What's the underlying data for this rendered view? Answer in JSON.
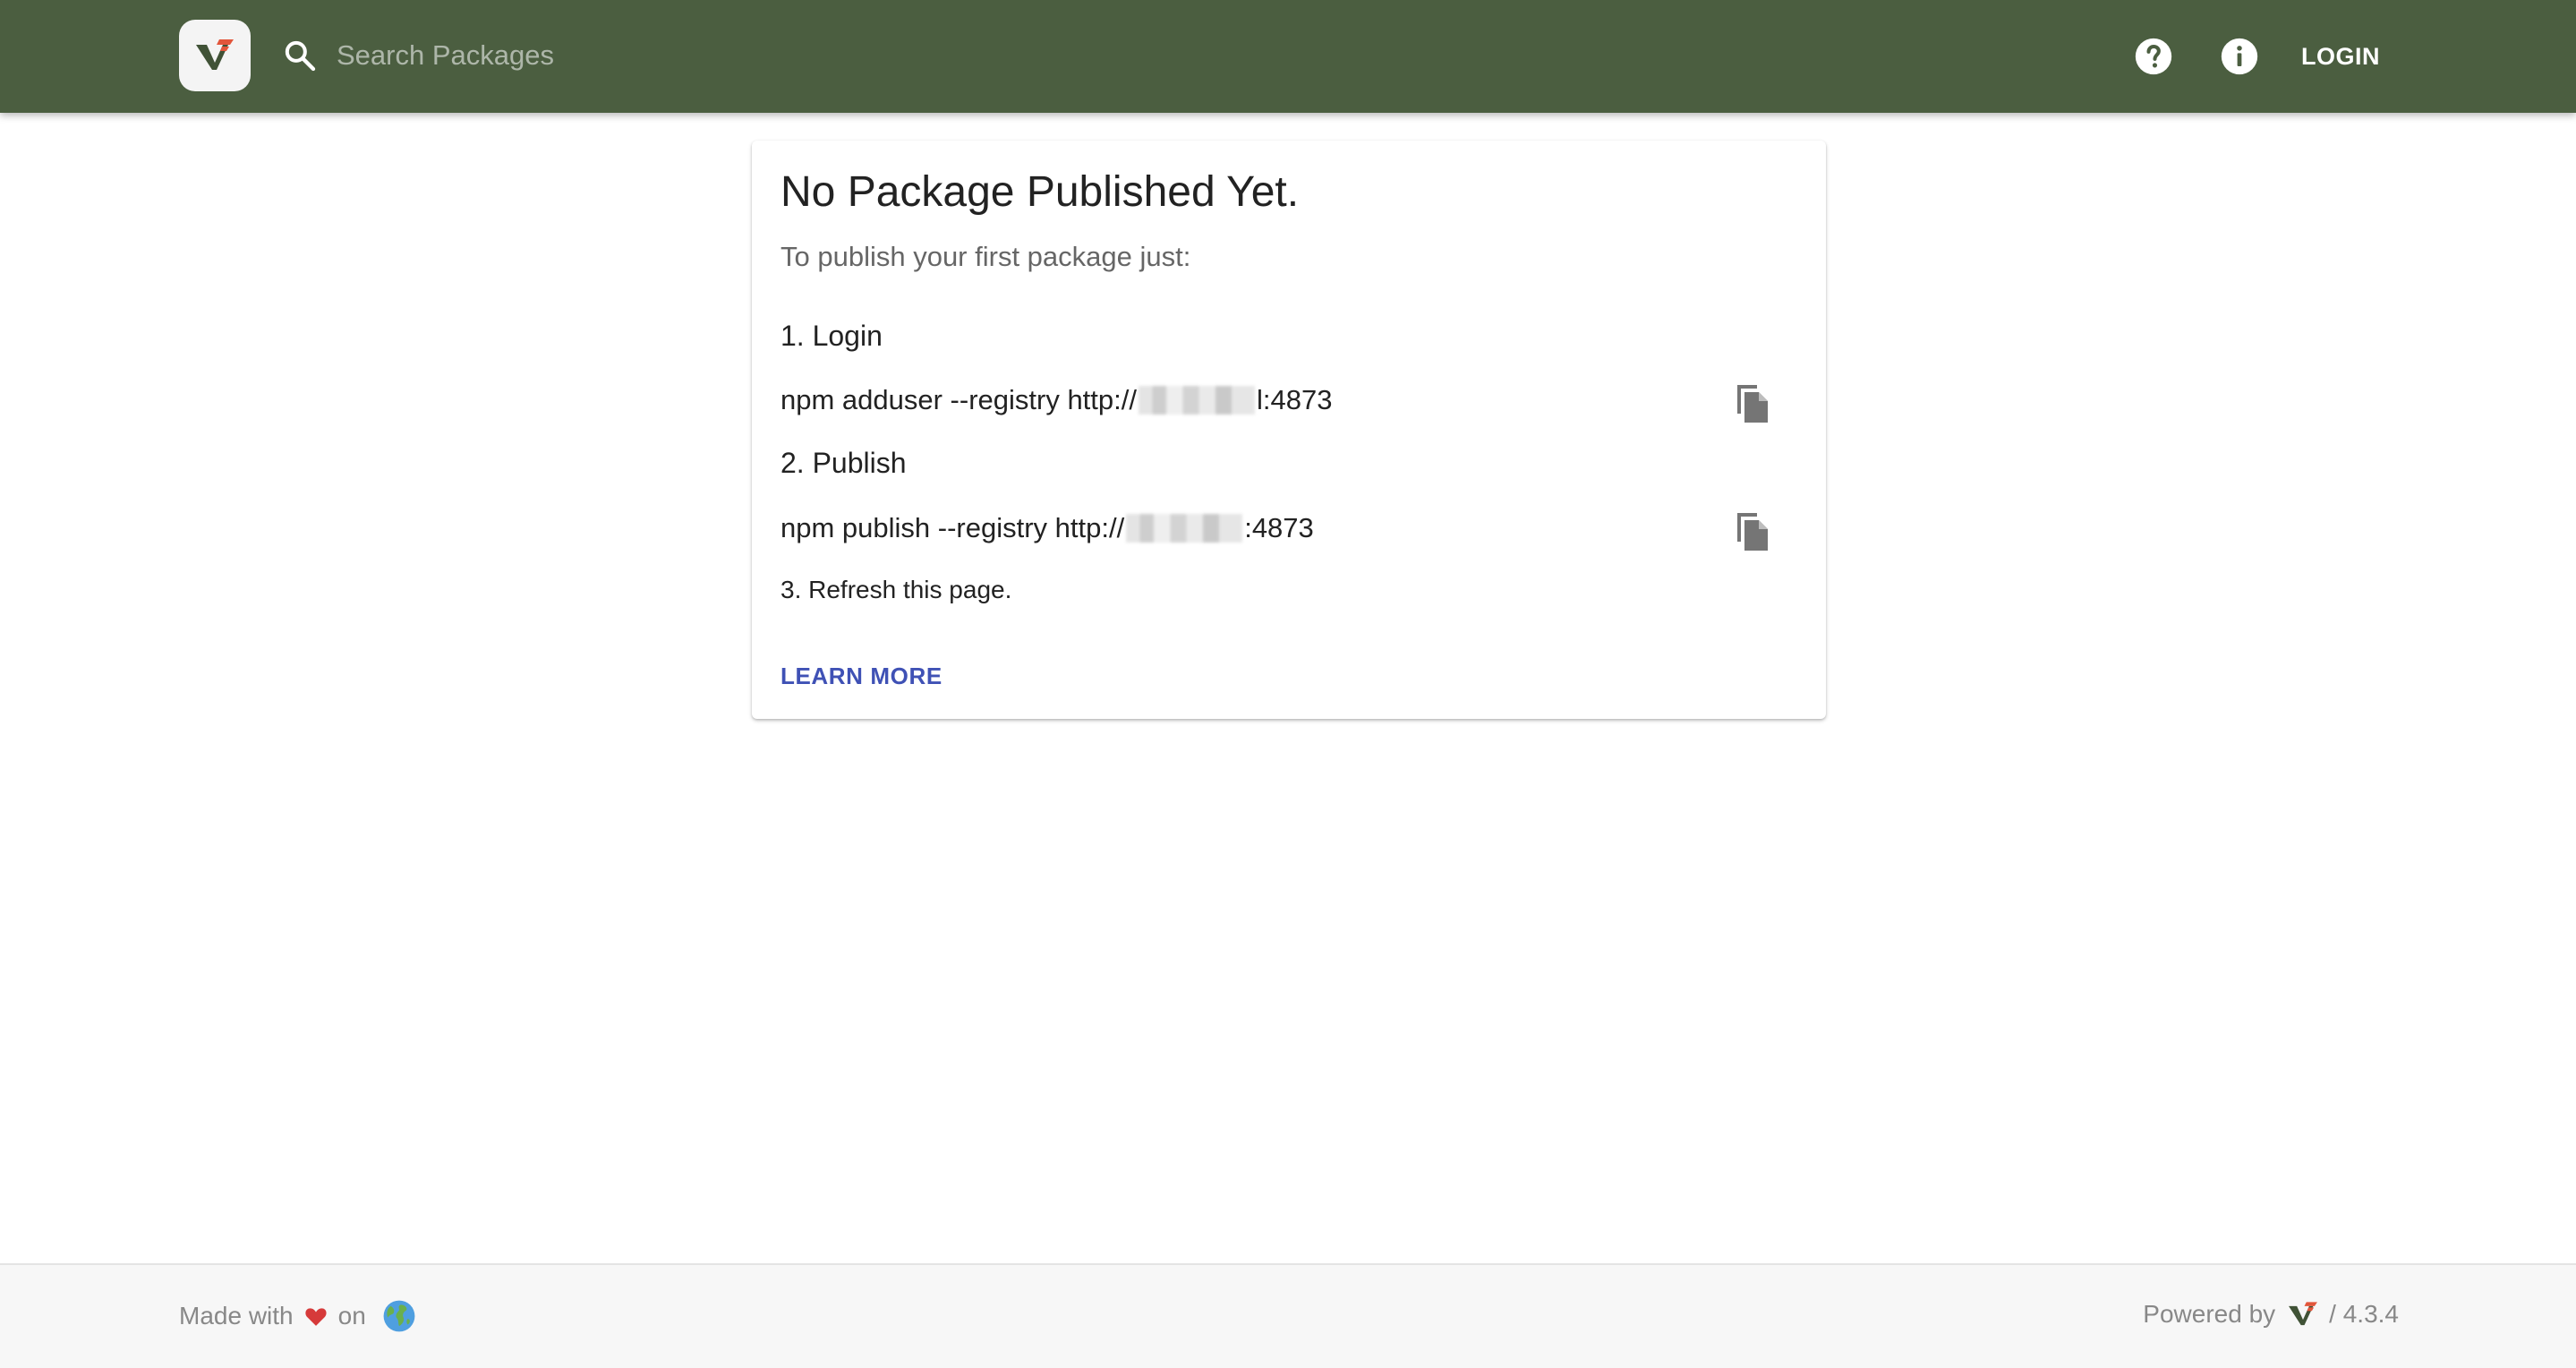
{
  "header": {
    "search_placeholder": "Search Packages",
    "login_label": "LOGIN",
    "background_color": "#4b5e40",
    "icons": {
      "logo": "verdaccio-logo",
      "search": "search-icon",
      "help": "help-icon",
      "info": "info-icon"
    }
  },
  "card": {
    "title": "No Package Published Yet.",
    "subtitle": "To publish your first package just:",
    "steps": [
      {
        "heading": "1. Login",
        "command_prefix": "npm adduser --registry http://",
        "command_suffix": "l:4873",
        "copy_icon": "copy-icon"
      },
      {
        "heading": "2. Publish",
        "command_prefix": "npm publish --registry http://",
        "command_suffix": ":4873",
        "copy_icon": "copy-icon"
      }
    ],
    "step3": "3. Refresh this page.",
    "learn_more_label": "LEARN MORE",
    "link_color": "#3f51b5"
  },
  "footer": {
    "made_with": "Made with",
    "on": "on",
    "powered_by": "Powered by",
    "version": "/ 4.3.4",
    "icons": {
      "heart": "heart-icon",
      "globe": "globe-icon",
      "logo": "verdaccio-logo"
    }
  }
}
